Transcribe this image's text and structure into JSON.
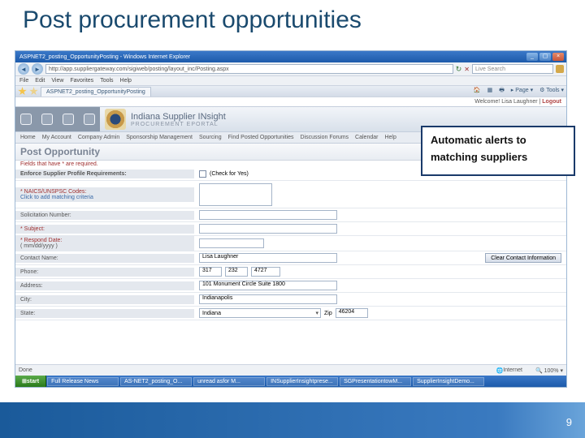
{
  "slide": {
    "title": "Post procurement opportunities",
    "page_num": "9"
  },
  "callout": {
    "line1": "Automatic alerts to",
    "line2": "matching suppliers"
  },
  "browser": {
    "title": "ASPNET2_posting_OpportunityPosting - Windows Internet Explorer",
    "url": "http://app.suppliergateway.com/sigiweb/posting/layout_inc/Posting.aspx",
    "search_placeholder": "Live Search",
    "menu": [
      "File",
      "Edit",
      "View",
      "Favorites",
      "Tools",
      "Help"
    ],
    "tab_label": "ASPNET2_posting_OpportunityPosting",
    "tab_tools": {
      "page": "Page",
      "tools": "Tools"
    },
    "status": {
      "done": "Done",
      "zone": "Internet",
      "zoom": "100%"
    }
  },
  "portal": {
    "welcome_prefix": "Welcome! ",
    "welcome_user": "Lisa Laughner",
    "logout": "Logout",
    "brand_line1": "Indiana Supplier INsight",
    "brand_line2": "PROCUREMENT EPORTAL",
    "nav": [
      "Home",
      "My Account",
      "Company Admin",
      "Sponsorship Management",
      "Sourcing",
      "Find Posted Opportunities",
      "Discussion Forums",
      "Calendar",
      "Help"
    ],
    "page_title": "Post Opportunity",
    "required_note": "Fields that have * are required.",
    "rows": {
      "enforce": {
        "label": "Enforce Supplier Profile Requirements:",
        "check_text": "(Check for Yes)"
      },
      "naics": {
        "label": "* NAICS/UNSPSC Codes:",
        "link": "Click to add matching criteria"
      },
      "solicitation": {
        "label": "Solicitation Number:"
      },
      "subject": {
        "label": "* Subject:"
      },
      "respond": {
        "label": "* Respond Date:",
        "hint": "( mm/dd/yyyy )"
      },
      "contact": {
        "label": "Contact Name:",
        "value": "Lisa Laughner",
        "btn": "Clear Contact Information"
      },
      "phone": {
        "label": "Phone:",
        "p1": "317",
        "p2": "232",
        "p3": "4727"
      },
      "address": {
        "label": "Address:",
        "value": "101 Monument Circle Suite 1800"
      },
      "city": {
        "label": "City:",
        "value": "Indianapolis"
      },
      "state": {
        "label": "State:",
        "value": "Indiana",
        "zip_label": "Zip",
        "zip": "46204"
      }
    }
  },
  "taskbar": {
    "start": "start",
    "items": [
      "Full Release News",
      "AS-NET2_posting_O...",
      "unread asfor M...",
      "INSupplierInsightprese...",
      "SGPresentationtowM...",
      "SupplierInsightDemo..."
    ]
  }
}
